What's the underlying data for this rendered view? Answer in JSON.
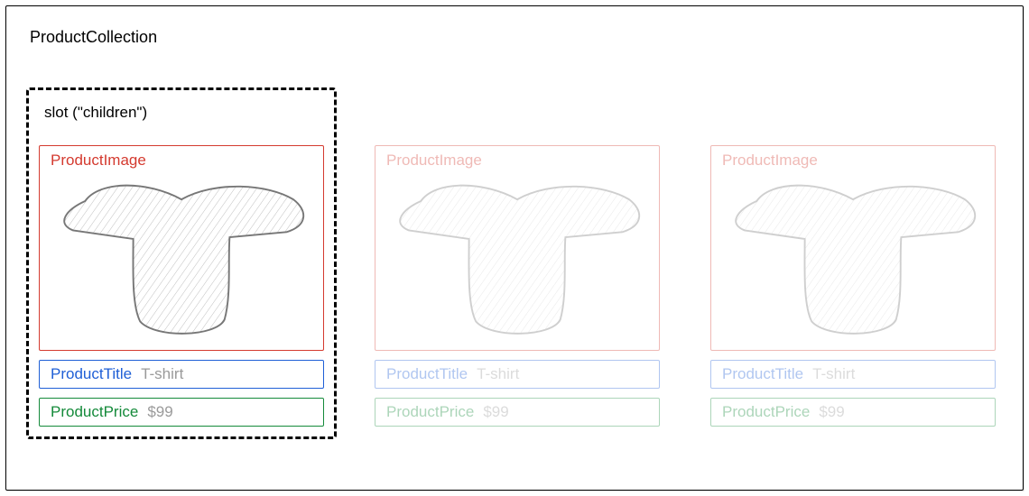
{
  "collection_label": "ProductCollection",
  "slot_label": "slot (\"children\")",
  "component_labels": {
    "image": "ProductImage",
    "title": "ProductTitle",
    "price": "ProductPrice"
  },
  "products": [
    {
      "title": "T-shirt",
      "price": "$99",
      "image_icon": "tshirt-icon",
      "emphasized": true
    },
    {
      "title": "T-shirt",
      "price": "$99",
      "image_icon": "tshirt-icon",
      "emphasized": false
    },
    {
      "title": "T-shirt",
      "price": "$99",
      "image_icon": "tshirt-icon",
      "emphasized": false
    }
  ],
  "colors": {
    "image_border": "#d43a2f",
    "title_border": "#1f5fd6",
    "price_border": "#148a3a",
    "value_text": "#9a9a9a"
  }
}
